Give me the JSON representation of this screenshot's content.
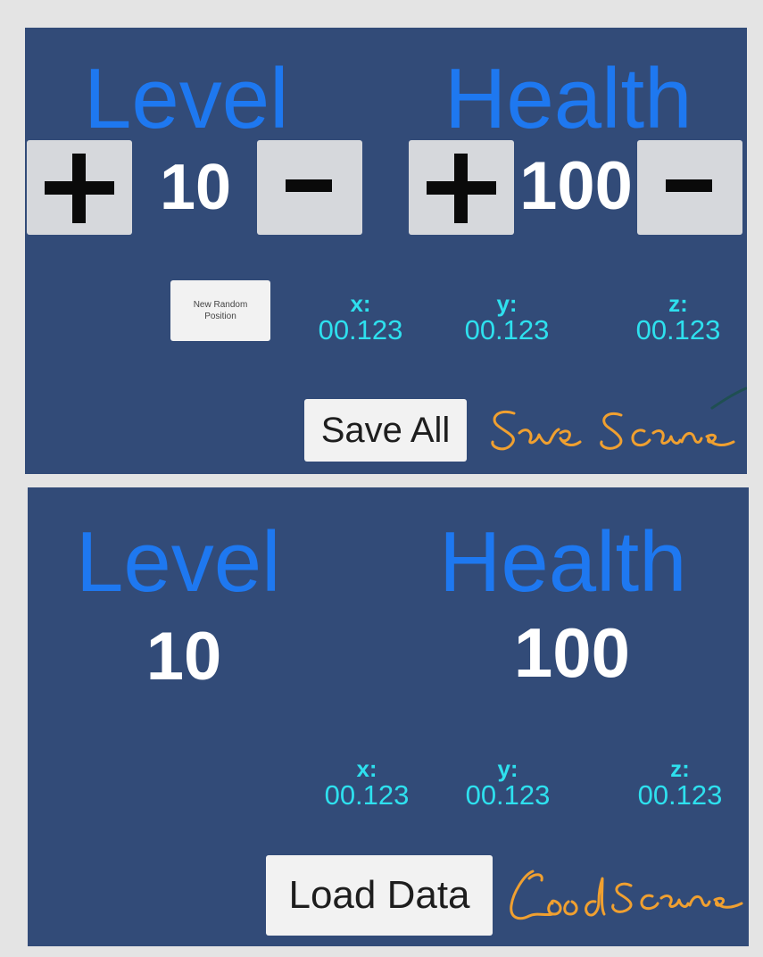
{
  "save_panel": {
    "level": {
      "title": "Level",
      "value": "10",
      "increment_label": "+",
      "decrement_label": "-"
    },
    "health": {
      "title": "Health",
      "value": "100",
      "increment_label": "+",
      "decrement_label": "-"
    },
    "random_button_label": "New Random Position",
    "coords": [
      {
        "label": "x:",
        "value": "00.123"
      },
      {
        "label": "y:",
        "value": "00.123"
      },
      {
        "label": "z:",
        "value": "00.123"
      }
    ],
    "action_button_label": "Save All",
    "handwritten_note": "Save Scene"
  },
  "load_panel": {
    "level": {
      "title": "Level",
      "value": "10"
    },
    "health": {
      "title": "Health",
      "value": "100"
    },
    "coords": [
      {
        "label": "x:",
        "value": "00.123"
      },
      {
        "label": "y:",
        "value": "00.123"
      },
      {
        "label": "z:",
        "value": "00.123"
      }
    ],
    "action_button_label": "Load Data",
    "handwritten_note": "Load scene"
  },
  "colors": {
    "panel_background": "#324b78",
    "title_blue": "#1e78f0",
    "coord_cyan": "#2ee0ee",
    "annotation_orange": "#f0a030"
  }
}
